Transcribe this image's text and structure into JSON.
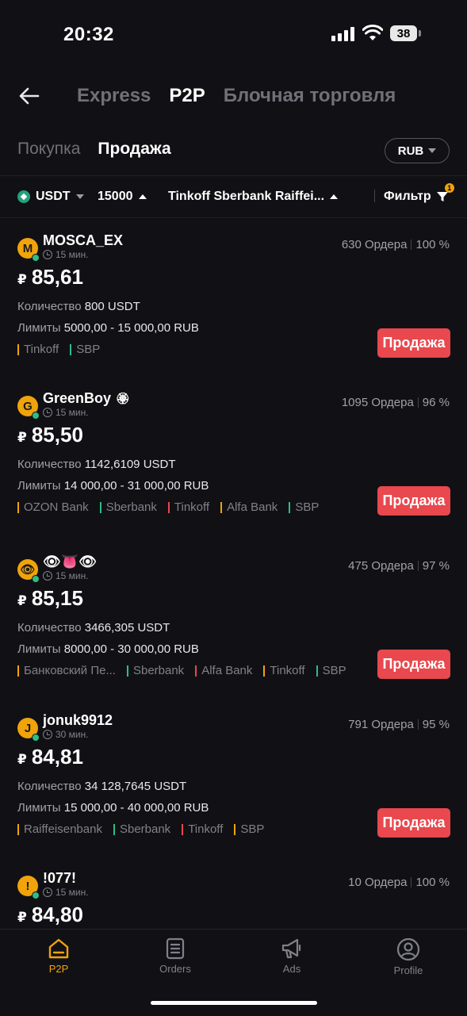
{
  "status": {
    "time": "20:32",
    "battery": "38"
  },
  "header": {
    "tabs": [
      {
        "label": "Express",
        "active": false
      },
      {
        "label": "P2P",
        "active": true
      },
      {
        "label": "Блочная торговля",
        "active": false
      }
    ],
    "subtabs": [
      {
        "label": "Покупка",
        "active": false
      },
      {
        "label": "Продажа",
        "active": true
      }
    ],
    "currency": "RUB"
  },
  "filters": {
    "asset": "USDT",
    "amount": "15000",
    "payment": "Tinkoff Sberbank Raiffei...",
    "filter_label": "Фильтр",
    "filter_count": "1"
  },
  "colors": {
    "accent": "#f0a30a",
    "sell": "#e8484e",
    "online": "#2ebd85",
    "yellow_tag": "#f0a30a",
    "green_tag": "#2ebd85",
    "red_tag": "#e8484e"
  },
  "listings": [
    {
      "avatar": "M",
      "name": "MOSCA_EX",
      "time": "15 мин.",
      "orders": "630 Ордера",
      "completion": "100 %",
      "currency_symbol": "₽",
      "price": "85,61",
      "qty_label": "Количество",
      "qty": "800 USDT",
      "limits_label": "Лимиты",
      "limits": "5000,00 - 15 000,00 RUB",
      "methods": [
        {
          "name": "Tinkoff",
          "color": "yellow"
        },
        {
          "name": "SBP",
          "color": "green"
        }
      ],
      "action": "Продажа"
    },
    {
      "avatar": "G",
      "name": "GreenBoy",
      "name_icon": "🏵",
      "time": "15 мин.",
      "orders": "1095 Ордера",
      "completion": "96 %",
      "currency_symbol": "₽",
      "price": "85,50",
      "qty_label": "Количество",
      "qty": "1142,6109 USDT",
      "limits_label": "Лимиты",
      "limits": "14 000,00 - 31 000,00 RUB",
      "methods": [
        {
          "name": "OZON Bank",
          "color": "yellow"
        },
        {
          "name": "Sberbank",
          "color": "green"
        },
        {
          "name": "Tinkoff",
          "color": "red"
        },
        {
          "name": "Alfa Bank",
          "color": "yellow"
        },
        {
          "name": "SBP",
          "color": "green"
        }
      ],
      "action": "Продажа"
    },
    {
      "avatar": "👁",
      "name": "👁👅👁",
      "time": "15 мин.",
      "orders": "475 Ордера",
      "completion": "97 %",
      "currency_symbol": "₽",
      "price": "85,15",
      "qty_label": "Количество",
      "qty": "3466,305 USDT",
      "limits_label": "Лимиты",
      "limits": "8000,00 - 30 000,00 RUB",
      "methods": [
        {
          "name": "Банковский Пе...",
          "color": "yellow"
        },
        {
          "name": "Sberbank",
          "color": "green"
        },
        {
          "name": "Alfa Bank",
          "color": "red"
        },
        {
          "name": "Tinkoff",
          "color": "yellow"
        },
        {
          "name": "SBP",
          "color": "green"
        }
      ],
      "action": "Продажа"
    },
    {
      "avatar": "J",
      "name": "jonuk9912",
      "time": "30 мин.",
      "orders": "791 Ордера",
      "completion": "95 %",
      "currency_symbol": "₽",
      "price": "84,81",
      "qty_label": "Количество",
      "qty": "34 128,7645 USDT",
      "limits_label": "Лимиты",
      "limits": "15 000,00 - 40 000,00 RUB",
      "methods": [
        {
          "name": "Raiffeisenbank",
          "color": "yellow"
        },
        {
          "name": "Sberbank",
          "color": "green"
        },
        {
          "name": "Tinkoff",
          "color": "red"
        },
        {
          "name": "SBP",
          "color": "yellow"
        }
      ],
      "action": "Продажа"
    },
    {
      "avatar": "!",
      "name": "!077!",
      "time": "15 мин.",
      "orders": "10 Ордера",
      "completion": "100 %",
      "currency_symbol": "₽",
      "price": "84,80"
    }
  ],
  "bottom_nav": [
    {
      "label": "P2P",
      "icon": "p2p-home-icon",
      "active": true
    },
    {
      "label": "Orders",
      "icon": "orders-icon",
      "active": false
    },
    {
      "label": "Ads",
      "icon": "megaphone-icon",
      "active": false
    },
    {
      "label": "Profile",
      "icon": "profile-icon",
      "active": false
    }
  ]
}
